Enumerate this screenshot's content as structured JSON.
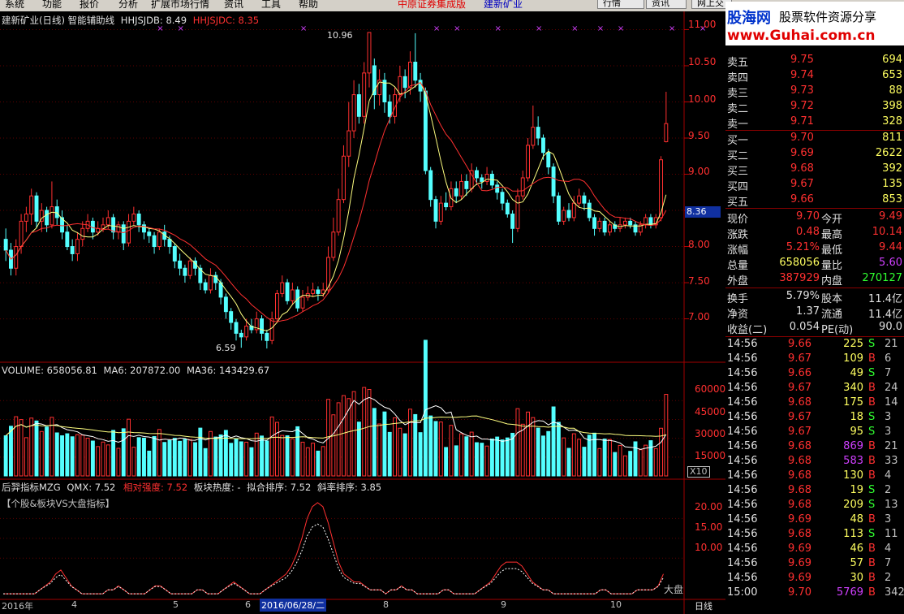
{
  "menu": [
    "系统",
    "功能",
    "报价",
    "分析",
    "扩展市场行情",
    "资讯",
    "工具",
    "帮助"
  ],
  "menu_center": {
    "broker": "中原证券集成版",
    "stock": "建新矿业"
  },
  "toolbar": [
    "行情",
    "资讯",
    "网上交"
  ],
  "watermark": {
    "logo": "股海网",
    "tagline": "股票软件资源分享",
    "url": "www.Guhai.com.cn"
  },
  "main": {
    "title": "建新矿业(日线) 智能辅助线",
    "hj_label": "HHJSJDB: 8.49",
    "hc_label": "HHJSJDC: 8.35",
    "high_mark": "10.96",
    "low_mark": "6.59",
    "price_tag": "8.36",
    "yaxis": [
      "11.00",
      "10.50",
      "10.00",
      "9.50",
      "9.00",
      "8.50",
      "8.00",
      "7.50",
      "7.00"
    ]
  },
  "volume": {
    "title": "VOLUME: 658056.81",
    "ma6": "MA6: 207872.00",
    "ma36": "MA36: 143429.67",
    "yaxis": [
      "60000",
      "45000",
      "30000",
      "15000"
    ],
    "unit": "X10"
  },
  "indicator": {
    "title": "后羿指标MZG",
    "qmx": "QMX: 7.52",
    "xdqd": "相对强度: 7.52",
    "bkrd": "板块热度: -",
    "nhpx": "拟合排序: 7.52",
    "xlpx": "斜率排序: 3.85",
    "subtitle": "【个股&板块VS大盘指标】",
    "yaxis": [
      "20.00",
      "15.00",
      "10.00"
    ],
    "market_label": "大盘"
  },
  "timeaxis": {
    "labels": [
      "2016年",
      "4",
      "5",
      "6",
      "8",
      "9",
      "10"
    ],
    "cursor": "2016/06/28/二",
    "period": "日线"
  },
  "quote": {
    "asks": [
      {
        "l": "卖五",
        "p": "9.75",
        "v": "694"
      },
      {
        "l": "卖四",
        "p": "9.74",
        "v": "653"
      },
      {
        "l": "卖三",
        "p": "9.73",
        "v": "88"
      },
      {
        "l": "卖二",
        "p": "9.72",
        "v": "398"
      },
      {
        "l": "卖一",
        "p": "9.71",
        "v": "328"
      }
    ],
    "bids": [
      {
        "l": "买一",
        "p": "9.70",
        "v": "811"
      },
      {
        "l": "买二",
        "p": "9.69",
        "v": "2622"
      },
      {
        "l": "买三",
        "p": "9.68",
        "v": "392"
      },
      {
        "l": "买四",
        "p": "9.67",
        "v": "135"
      },
      {
        "l": "买五",
        "p": "9.66",
        "v": "853"
      }
    ],
    "stats": [
      {
        "a": "现价",
        "av": "9.70",
        "b": "今开",
        "bv": "9.49"
      },
      {
        "a": "涨跌",
        "av": "0.48",
        "b": "最高",
        "bv": "10.14"
      },
      {
        "a": "涨幅",
        "av": "5.21%",
        "b": "最低",
        "bv": "9.44"
      },
      {
        "a": "总量",
        "av": "658056",
        "b": "量比",
        "bv": "5.60"
      },
      {
        "a": "外盘",
        "av": "387929",
        "b": "内盘",
        "bv": "270127"
      }
    ],
    "stats2": [
      {
        "a": "换手",
        "av": "5.79%",
        "b": "股本",
        "bv": "11.4亿"
      },
      {
        "a": "净资",
        "av": "1.37",
        "b": "流通",
        "bv": "11.4亿"
      },
      {
        "a": "收益(二)",
        "av": "0.054",
        "b": "PE(动)",
        "bv": "90.0"
      }
    ],
    "ticks": [
      {
        "t": "14:56",
        "p": "9.66",
        "v": "225",
        "s": "S",
        "n": "21"
      },
      {
        "t": "14:56",
        "p": "9.67",
        "v": "109",
        "s": "B",
        "n": "6"
      },
      {
        "t": "14:56",
        "p": "9.66",
        "v": "49",
        "s": "S",
        "n": "7"
      },
      {
        "t": "14:56",
        "p": "9.67",
        "v": "340",
        "s": "B",
        "n": "24"
      },
      {
        "t": "14:56",
        "p": "9.68",
        "v": "175",
        "s": "B",
        "n": "14"
      },
      {
        "t": "14:56",
        "p": "9.67",
        "v": "18",
        "s": "S",
        "n": "3"
      },
      {
        "t": "14:56",
        "p": "9.67",
        "v": "95",
        "s": "S",
        "n": "3"
      },
      {
        "t": "14:56",
        "p": "9.68",
        "v": "869",
        "s": "B",
        "n": "21"
      },
      {
        "t": "14:56",
        "p": "9.68",
        "v": "583",
        "s": "B",
        "n": "33"
      },
      {
        "t": "14:56",
        "p": "9.68",
        "v": "130",
        "s": "B",
        "n": "4"
      },
      {
        "t": "14:56",
        "p": "9.68",
        "v": "19",
        "s": "S",
        "n": "2"
      },
      {
        "t": "14:56",
        "p": "9.68",
        "v": "209",
        "s": "S",
        "n": "13"
      },
      {
        "t": "14:56",
        "p": "9.69",
        "v": "48",
        "s": "B",
        "n": "3"
      },
      {
        "t": "14:56",
        "p": "9.68",
        "v": "113",
        "s": "S",
        "n": "11"
      },
      {
        "t": "14:56",
        "p": "9.69",
        "v": "46",
        "s": "B",
        "n": "4"
      },
      {
        "t": "14:56",
        "p": "9.69",
        "v": "57",
        "s": "B",
        "n": "7"
      },
      {
        "t": "14:56",
        "p": "9.69",
        "v": "30",
        "s": "B",
        "n": "2"
      },
      {
        "t": "15:00",
        "p": "9.70",
        "v": "5769",
        "s": "B",
        "n": "342"
      }
    ]
  },
  "chart_data": {
    "type": "candlestick",
    "price_ylim": [
      6.4,
      11.05
    ],
    "candles": [
      [
        8.1,
        7.95,
        8.25,
        7.8
      ],
      [
        7.95,
        7.7,
        8.05,
        7.6
      ],
      [
        7.7,
        8.0,
        8.1,
        7.6
      ],
      [
        8.0,
        8.35,
        8.45,
        7.9
      ],
      [
        8.35,
        8.45,
        8.55,
        8.2
      ],
      [
        8.45,
        8.7,
        8.8,
        8.3
      ],
      [
        8.7,
        8.35,
        8.75,
        8.25
      ],
      [
        8.35,
        8.5,
        8.6,
        8.2
      ],
      [
        8.5,
        8.3,
        8.55,
        8.2
      ],
      [
        8.3,
        8.55,
        8.9,
        8.25
      ],
      [
        8.55,
        8.4,
        8.65,
        8.3
      ],
      [
        8.4,
        8.2,
        8.5,
        8.1
      ],
      [
        8.2,
        8.0,
        8.3,
        7.95
      ],
      [
        8.0,
        7.9,
        8.1,
        7.8
      ],
      [
        7.9,
        8.1,
        8.2,
        7.8
      ],
      [
        8.1,
        8.25,
        8.35,
        8.0
      ],
      [
        8.25,
        8.35,
        8.45,
        8.2
      ],
      [
        8.35,
        8.2,
        8.4,
        8.1
      ],
      [
        8.2,
        8.25,
        8.35,
        8.15
      ],
      [
        8.25,
        8.3,
        8.4,
        8.2
      ],
      [
        8.3,
        8.4,
        8.5,
        8.25
      ],
      [
        8.4,
        8.2,
        8.45,
        8.1
      ],
      [
        8.2,
        8.3,
        8.35,
        8.1
      ],
      [
        8.3,
        8.05,
        8.35,
        7.95
      ],
      [
        8.05,
        8.35,
        8.45,
        8.0
      ],
      [
        8.35,
        8.45,
        8.55,
        8.3
      ],
      [
        8.45,
        8.3,
        8.5,
        8.2
      ],
      [
        8.3,
        8.2,
        8.35,
        8.1
      ],
      [
        8.2,
        8.15,
        8.25,
        8.05
      ],
      [
        8.15,
        8.0,
        8.2,
        7.9
      ],
      [
        8.0,
        8.2,
        8.25,
        7.95
      ],
      [
        8.2,
        8.1,
        8.3,
        8.0
      ],
      [
        8.1,
        8.0,
        8.15,
        7.9
      ],
      [
        8.0,
        7.8,
        8.05,
        7.7
      ],
      [
        7.8,
        7.7,
        7.9,
        7.6
      ],
      [
        7.7,
        7.6,
        7.75,
        7.5
      ],
      [
        7.6,
        7.8,
        7.85,
        7.55
      ],
      [
        7.8,
        7.7,
        7.85,
        7.6
      ],
      [
        7.7,
        7.5,
        7.75,
        7.4
      ],
      [
        7.5,
        7.4,
        7.55,
        7.35
      ],
      [
        7.4,
        7.6,
        7.7,
        7.35
      ],
      [
        7.6,
        7.5,
        7.65,
        7.4
      ],
      [
        7.5,
        7.3,
        7.55,
        7.2
      ],
      [
        7.3,
        7.1,
        7.35,
        7.0
      ],
      [
        7.1,
        6.95,
        7.15,
        6.85
      ],
      [
        6.95,
        6.8,
        7.0,
        6.7
      ],
      [
        6.8,
        6.75,
        6.85,
        6.6
      ],
      [
        6.75,
        6.9,
        7.0,
        6.7
      ],
      [
        6.9,
        6.85,
        7.0,
        6.8
      ],
      [
        6.85,
        7.0,
        7.1,
        6.8
      ],
      [
        7.0,
        6.8,
        7.05,
        6.7
      ],
      [
        6.8,
        6.7,
        6.85,
        6.59
      ],
      [
        6.7,
        7.0,
        7.1,
        6.65
      ],
      [
        7.0,
        7.35,
        7.4,
        6.95
      ],
      [
        7.35,
        7.5,
        7.6,
        7.3
      ],
      [
        7.5,
        7.25,
        7.55,
        7.2
      ],
      [
        7.25,
        7.4,
        7.5,
        7.2
      ],
      [
        7.4,
        7.15,
        7.45,
        7.1
      ],
      [
        7.15,
        7.3,
        7.4,
        7.1
      ],
      [
        7.3,
        7.35,
        7.45,
        7.25
      ],
      [
        7.35,
        7.4,
        7.5,
        7.3
      ],
      [
        7.4,
        7.35,
        7.45,
        7.25
      ],
      [
        7.35,
        7.4,
        7.5,
        7.3
      ],
      [
        7.4,
        7.85,
        8.0,
        7.35
      ],
      [
        7.85,
        8.2,
        8.4,
        7.8
      ],
      [
        8.2,
        8.65,
        8.8,
        8.15
      ],
      [
        8.65,
        9.25,
        9.4,
        8.6
      ],
      [
        9.25,
        9.6,
        10.0,
        9.1
      ],
      [
        9.6,
        10.1,
        10.3,
        9.5
      ],
      [
        10.1,
        9.8,
        10.25,
        9.7
      ],
      [
        9.8,
        10.4,
        10.55,
        9.7
      ],
      [
        10.4,
        10.96,
        10.96,
        10.2
      ],
      [
        10.5,
        10.1,
        10.6,
        9.9
      ],
      [
        10.1,
        10.3,
        10.45,
        9.95
      ],
      [
        10.3,
        10.0,
        10.4,
        9.85
      ],
      [
        10.0,
        9.8,
        10.1,
        9.7
      ],
      [
        9.8,
        10.1,
        10.2,
        9.7
      ],
      [
        10.1,
        10.35,
        10.5,
        10.0
      ],
      [
        10.35,
        10.2,
        10.45,
        10.05
      ],
      [
        10.2,
        10.55,
        10.7,
        10.1
      ],
      [
        10.55,
        10.3,
        10.95,
        10.2
      ],
      [
        10.3,
        10.15,
        10.4,
        10.0
      ],
      [
        10.15,
        9.05,
        10.2,
        9.0
      ],
      [
        9.05,
        8.65,
        9.1,
        8.55
      ],
      [
        8.65,
        8.35,
        8.7,
        8.25
      ],
      [
        8.35,
        8.6,
        8.7,
        8.3
      ],
      [
        8.6,
        8.55,
        8.75,
        8.5
      ],
      [
        8.55,
        8.8,
        8.9,
        8.5
      ],
      [
        8.8,
        8.7,
        8.9,
        8.6
      ],
      [
        8.7,
        8.9,
        9.0,
        8.65
      ],
      [
        8.9,
        8.8,
        9.0,
        8.7
      ],
      [
        8.8,
        9.05,
        9.15,
        8.75
      ],
      [
        9.05,
        8.95,
        9.1,
        8.85
      ],
      [
        8.95,
        8.9,
        9.0,
        8.8
      ],
      [
        8.9,
        9.0,
        9.1,
        8.85
      ],
      [
        9.0,
        8.85,
        9.05,
        8.8
      ],
      [
        8.85,
        8.75,
        8.9,
        8.65
      ],
      [
        8.75,
        8.6,
        8.8,
        8.5
      ],
      [
        8.6,
        8.45,
        8.65,
        8.4
      ],
      [
        8.45,
        8.25,
        8.5,
        8.05
      ],
      [
        8.25,
        8.7,
        8.8,
        8.2
      ],
      [
        8.7,
        8.95,
        9.05,
        8.65
      ],
      [
        8.95,
        9.4,
        9.5,
        8.9
      ],
      [
        9.4,
        9.65,
        9.95,
        9.35
      ],
      [
        9.65,
        9.5,
        9.8,
        9.4
      ],
      [
        9.5,
        9.3,
        9.55,
        9.2
      ],
      [
        9.3,
        9.1,
        9.35,
        9.0
      ],
      [
        9.1,
        8.7,
        9.15,
        8.6
      ],
      [
        8.7,
        8.35,
        8.75,
        8.3
      ],
      [
        8.35,
        8.5,
        8.55,
        8.3
      ],
      [
        8.5,
        8.4,
        8.6,
        8.35
      ],
      [
        8.4,
        8.6,
        8.7,
        8.35
      ],
      [
        8.6,
        8.7,
        8.8,
        8.55
      ],
      [
        8.7,
        8.6,
        8.75,
        8.5
      ],
      [
        8.6,
        8.4,
        8.65,
        8.35
      ],
      [
        8.4,
        8.25,
        8.45,
        8.15
      ],
      [
        8.25,
        8.35,
        8.4,
        8.2
      ],
      [
        8.35,
        8.2,
        8.4,
        8.15
      ],
      [
        8.2,
        8.3,
        8.35,
        8.15
      ],
      [
        8.3,
        8.25,
        8.35,
        8.2
      ],
      [
        8.25,
        8.3,
        8.4,
        8.2
      ],
      [
        8.3,
        8.35,
        8.4,
        8.25
      ],
      [
        8.35,
        8.3,
        8.4,
        8.25
      ],
      [
        8.3,
        8.2,
        8.35,
        8.15
      ],
      [
        8.2,
        8.3,
        8.35,
        8.15
      ],
      [
        8.3,
        8.4,
        8.45,
        8.25
      ],
      [
        8.4,
        8.3,
        8.45,
        8.25
      ],
      [
        8.3,
        8.4,
        8.45,
        8.25
      ],
      [
        8.4,
        9.2,
        9.25,
        8.35
      ],
      [
        9.45,
        9.7,
        10.14,
        9.44
      ]
    ],
    "indicator_ylim": [
      0,
      25
    ],
    "indicator_red": [
      1,
      1,
      1,
      1,
      1,
      1,
      1,
      2,
      3,
      4,
      6,
      7,
      5,
      3,
      2,
      1,
      1,
      1,
      1,
      1,
      2,
      2,
      3,
      2,
      1,
      1,
      1,
      1,
      2,
      3,
      3,
      2,
      1,
      1,
      1,
      1,
      1,
      2,
      2,
      1,
      1,
      1,
      2,
      3,
      4,
      3,
      2,
      1,
      1,
      1,
      2,
      3,
      4,
      5,
      6,
      8,
      11,
      15,
      20,
      23,
      24,
      23,
      19,
      14,
      9,
      6,
      5,
      4,
      4,
      3,
      2,
      2,
      2,
      1,
      2,
      2,
      3,
      2,
      2,
      1,
      1,
      1,
      1,
      1,
      2,
      2,
      1,
      1,
      1,
      1,
      1,
      2,
      3,
      4,
      6,
      8,
      9,
      9,
      9,
      8,
      6,
      4,
      3,
      2,
      2,
      1,
      1,
      1,
      1,
      1,
      1,
      1,
      1,
      1,
      2,
      2,
      1,
      1,
      1,
      1,
      1,
      2,
      2,
      2,
      2,
      3,
      6
    ]
  }
}
